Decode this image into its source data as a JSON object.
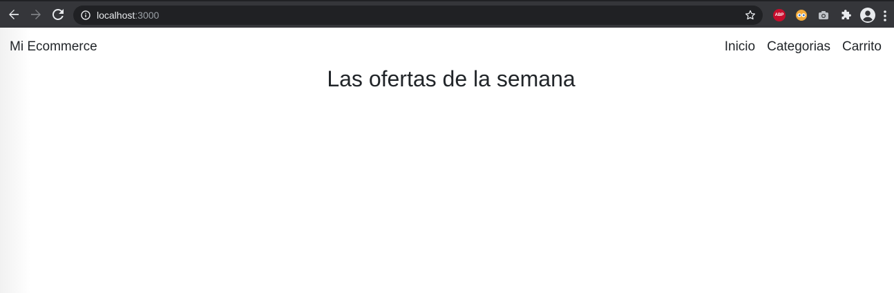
{
  "browser": {
    "url_host": "localhost",
    "url_port": ":3000",
    "extensions": [
      {
        "name": "adblock-plus",
        "label": "ABP"
      },
      {
        "name": "eyes-extension"
      },
      {
        "name": "camera-extension"
      },
      {
        "name": "puzzle-extensions"
      }
    ],
    "colors": {
      "toolbar": "#35363a",
      "omnibox": "#202124",
      "text": "#e8eaed",
      "muted": "#9aa0a6",
      "abp_red": "#c70d2c"
    }
  },
  "navbar": {
    "brand": "Mi Ecommerce",
    "links": [
      {
        "label": "Inicio"
      },
      {
        "label": "Categorias"
      },
      {
        "label": "Carrito"
      }
    ]
  },
  "main": {
    "title": "Las ofertas de la semana"
  },
  "colors": {
    "page_text": "#212529",
    "page_bg": "#ffffff"
  }
}
